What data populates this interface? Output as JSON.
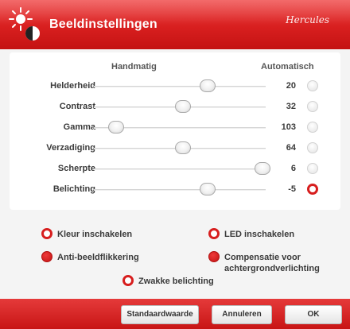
{
  "window": {
    "title": "Beeldinstellingen",
    "logo": "Hercules",
    "icon": "brightness-contrast-icon",
    "accent": "#d71e1e"
  },
  "columns": {
    "manual": "Handmatig",
    "automatic": "Automatisch"
  },
  "settings": [
    {
      "label": "Helderheid",
      "value": "20",
      "slider_fraction": 0.66,
      "auto": false
    },
    {
      "label": "Contrast",
      "value": "32",
      "slider_fraction": 0.52,
      "auto": false
    },
    {
      "label": "Gamma",
      "value": "103",
      "slider_fraction": 0.13,
      "auto": false
    },
    {
      "label": "Verzadiging",
      "value": "64",
      "slider_fraction": 0.52,
      "auto": false
    },
    {
      "label": "Scherpte",
      "value": "6",
      "slider_fraction": 0.98,
      "auto": false
    },
    {
      "label": "Belichting",
      "value": "-5",
      "slider_fraction": 0.66,
      "auto": true
    }
  ],
  "options": [
    {
      "name": "kleur-inschakelen",
      "label": "Kleur inschakelen",
      "style": "ring"
    },
    {
      "name": "led-inschakelen",
      "label": "LED inschakelen",
      "style": "ring"
    },
    {
      "name": "anti-beeldflikkering",
      "label": "Anti-beeldflikkering",
      "style": "dot"
    },
    {
      "name": "compensatie-achtergrondverlichting",
      "label_line1": "Compensatie voor",
      "label_line2": "achtergrondverlichting",
      "style": "dot"
    },
    {
      "name": "zwakke-belichting",
      "label": "Zwakke belichting",
      "style": "ring"
    }
  ],
  "buttons": {
    "default": "Standaardwaarde",
    "cancel": "Annuleren",
    "ok": "OK"
  }
}
